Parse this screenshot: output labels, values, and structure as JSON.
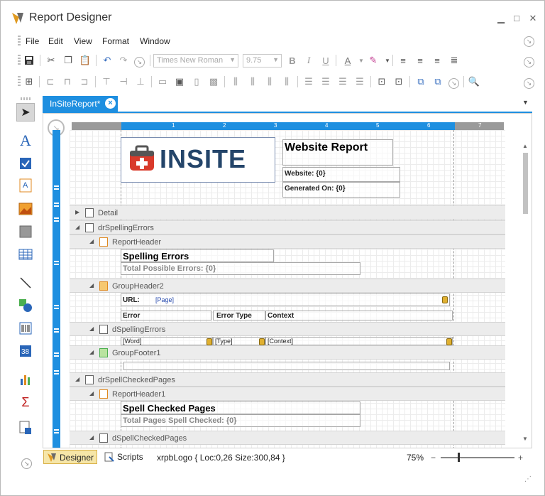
{
  "window": {
    "title": "Report Designer",
    "minimize": "▁",
    "maximize": "□",
    "close": "✕"
  },
  "menu": [
    "File",
    "Edit",
    "View",
    "Format",
    "Window"
  ],
  "format_toolbar": {
    "font_name": "Times New Roman",
    "font_size": "9.75",
    "bold": "B",
    "italic": "I",
    "underline": "U",
    "fore_color": "A"
  },
  "doc_tab": {
    "label": "InSiteReport*"
  },
  "ruler": {
    "ticks": [
      "1",
      "2",
      "3",
      "4",
      "5",
      "6",
      "7"
    ]
  },
  "report": {
    "logo_text": "INSITE",
    "title": "Website Report",
    "website": "Website: {0}",
    "generated_on": "Generated On: {0}",
    "bands": {
      "detail": "Detail",
      "dr_spelling_errors": "drSpellingErrors",
      "report_header": "ReportHeader",
      "group_header2": "GroupHeader2",
      "d_spelling_errors": "dSpellingErrors",
      "group_footer1": "GroupFooter1",
      "dr_spell_checked_pages": "drSpellCheckedPages",
      "report_header1": "ReportHeader1",
      "d_spell_checked_pages": "dSpellCheckedPages"
    },
    "spelling_errors_title": "Spelling Errors",
    "total_possible_errors": "Total Possible Errors: {0}",
    "url_label": "URL:",
    "page_bind": "[Page]",
    "col_error": "Error",
    "col_error_type": "Error Type",
    "col_context": "Context",
    "word_bind": "[Word]",
    "type_bind": "[Type]",
    "context_bind": "[Context]",
    "spell_checked_title": "Spell Checked Pages",
    "total_pages_checked": "Total Pages Spell Checked: {0}"
  },
  "status": {
    "designer_tab": "Designer",
    "scripts_tab": "Scripts",
    "selection_info": "xrpbLogo { Loc:0,26 Size:300,84 }",
    "zoom": "75%",
    "zoom_out": "−",
    "zoom_in": "+"
  },
  "colors": {
    "accent": "#1e8fe0",
    "active_status_tab": "#f6e6a8"
  }
}
